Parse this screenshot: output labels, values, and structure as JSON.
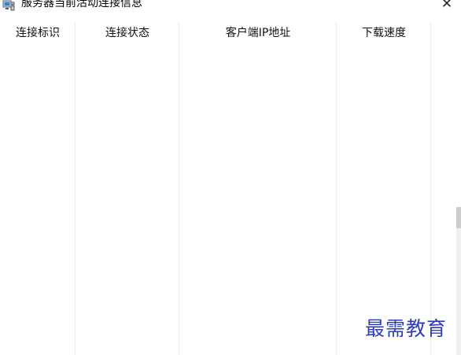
{
  "window": {
    "title": "服务器当前活动连接信息",
    "close_symbol": "✕",
    "icon": "server-monitor-icon"
  },
  "table": {
    "columns": [
      {
        "label": "连接标识"
      },
      {
        "label": "连接状态"
      },
      {
        "label": "客户端IP地址"
      },
      {
        "label": "下载速度"
      }
    ],
    "rows": []
  },
  "watermark": {
    "text": "最需教育"
  },
  "colors": {
    "watermark": "#2f3cb8",
    "grid_line": "#ececec"
  }
}
